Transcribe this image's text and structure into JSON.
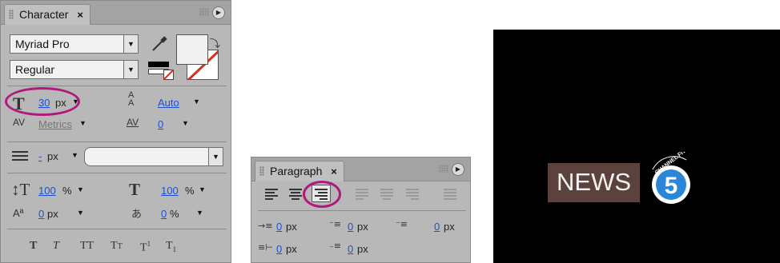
{
  "character_panel": {
    "tab_label": "Character",
    "close_glyph": "×",
    "menu_glyph": "▶",
    "font_family": "Myriad Pro",
    "font_style": "Regular",
    "font_size_value": "30",
    "font_size_unit": "px",
    "leading_value": "Auto",
    "kerning_value": "Metrics",
    "tracking_value": "0",
    "stroke_width_value": "-",
    "stroke_width_unit": "px",
    "vertical_scale_value": "100",
    "horizontal_scale_value": "100",
    "percent": "%",
    "baseline_shift_value": "0",
    "baseline_shift_unit": "px",
    "tsume_value": "0",
    "tsume_unit": "%",
    "highlight_color": "#b0187e",
    "fill_color": "#f0f0f0"
  },
  "paragraph_panel": {
    "tab_label": "Paragraph",
    "close_glyph": "×",
    "menu_glyph": "▶",
    "indent_left_value": "0",
    "indent_first_value": "0",
    "indent_right_value": "0",
    "space_before_value": "0",
    "space_after_value": "0",
    "unit": "px"
  },
  "preview": {
    "news_text": "NEWS",
    "logo_number": "5",
    "logo_arc_text": "CHANNEL FIVE",
    "background_color": "#000000",
    "news_box_color": "#5b423c",
    "logo_color": "#2a86d6"
  }
}
